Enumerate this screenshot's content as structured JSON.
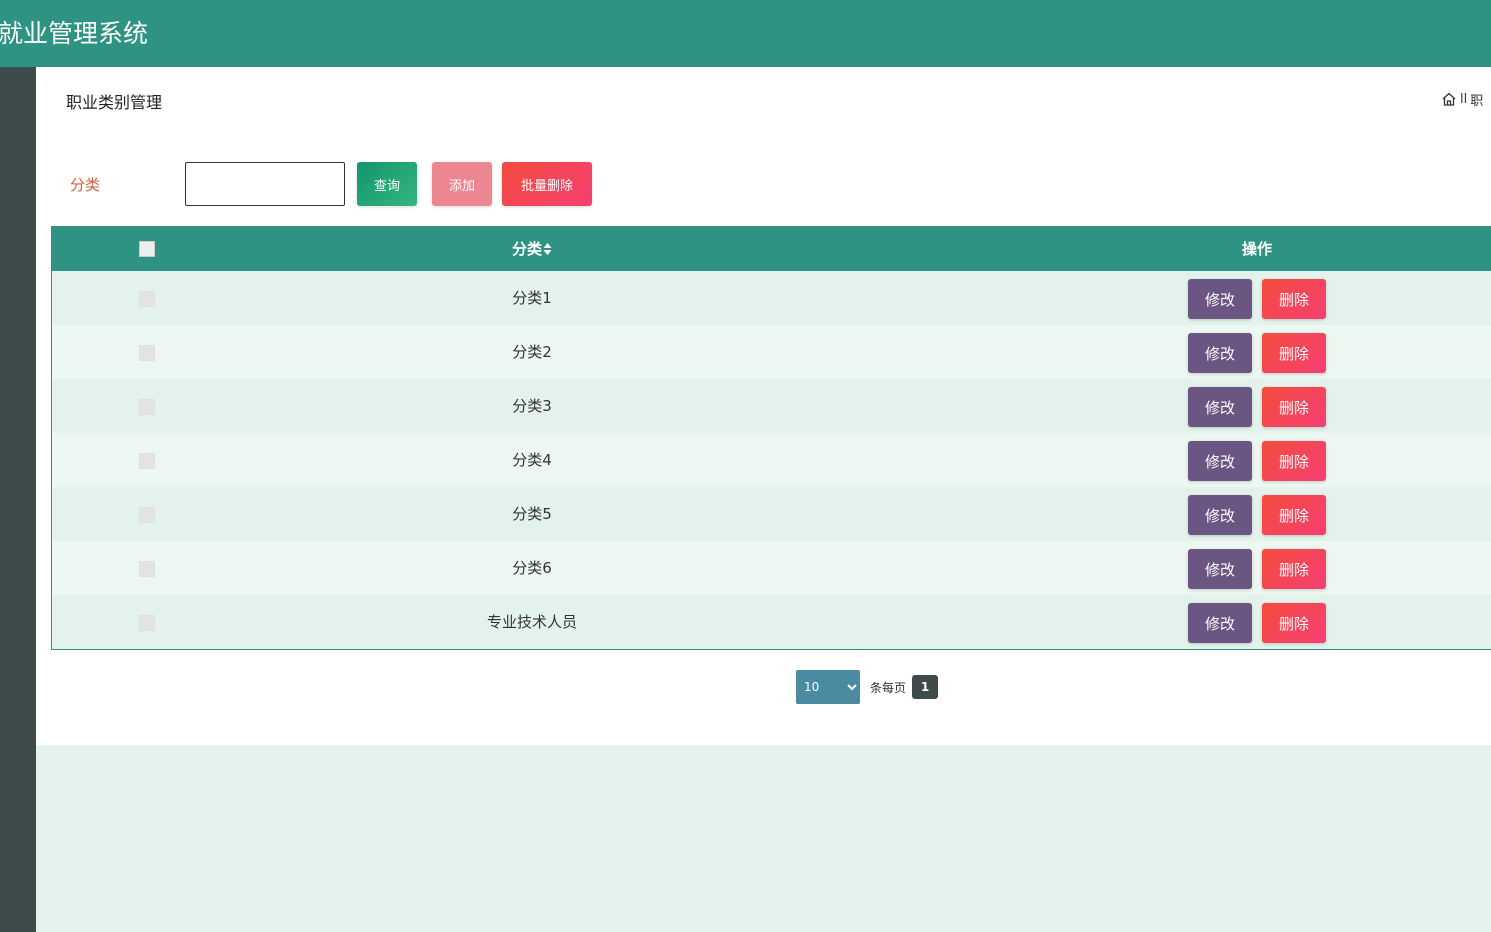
{
  "app": {
    "title": "就业管理系统"
  },
  "page": {
    "title": "职业类别管理",
    "breadcrumb_separator": "ll",
    "breadcrumb_text": "职"
  },
  "search": {
    "label": "分类",
    "value": "",
    "query_label": "查询",
    "add_label": "添加",
    "bulk_delete_label": "批量删除"
  },
  "table": {
    "columns": {
      "category": "分类",
      "operation": "操作"
    },
    "edit_label": "修改",
    "delete_label": "删除",
    "rows": [
      {
        "name": "分类1"
      },
      {
        "name": "分类2"
      },
      {
        "name": "分类3"
      },
      {
        "name": "分类4"
      },
      {
        "name": "分类5"
      },
      {
        "name": "分类6"
      },
      {
        "name": "专业技术人员"
      }
    ]
  },
  "pagination": {
    "page_size": "10",
    "per_page_label": "条每页",
    "current_page": "1"
  },
  "colors": {
    "primary": "#2f9384",
    "sidebar": "#3f4a4b",
    "edit_button": "#6b5582",
    "delete_button": "#f44c5a",
    "add_button": "#ec8792",
    "query_button": "#13956f"
  },
  "icons": {
    "home": "home-icon",
    "sort": "sort-icon"
  }
}
